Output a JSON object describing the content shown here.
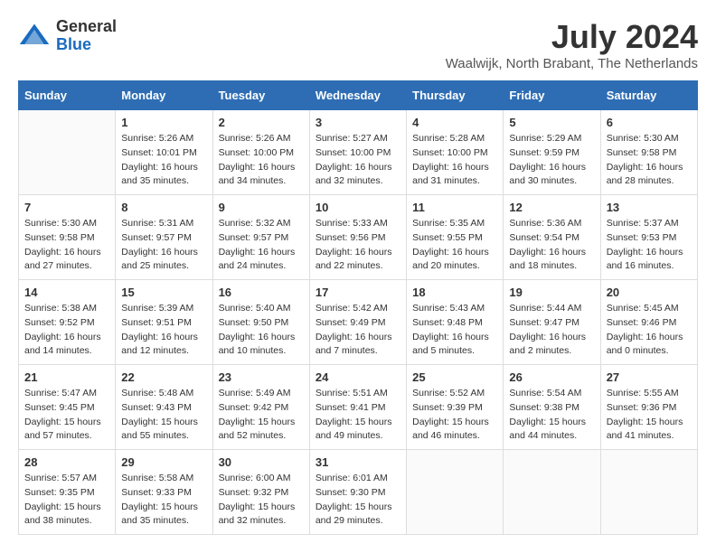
{
  "logo": {
    "general": "General",
    "blue": "Blue"
  },
  "title": "July 2024",
  "location": "Waalwijk, North Brabant, The Netherlands",
  "days_of_week": [
    "Sunday",
    "Monday",
    "Tuesday",
    "Wednesday",
    "Thursday",
    "Friday",
    "Saturday"
  ],
  "weeks": [
    [
      {
        "day": "",
        "info": ""
      },
      {
        "day": "1",
        "info": "Sunrise: 5:26 AM\nSunset: 10:01 PM\nDaylight: 16 hours and 35 minutes."
      },
      {
        "day": "2",
        "info": "Sunrise: 5:26 AM\nSunset: 10:00 PM\nDaylight: 16 hours and 34 minutes."
      },
      {
        "day": "3",
        "info": "Sunrise: 5:27 AM\nSunset: 10:00 PM\nDaylight: 16 hours and 32 minutes."
      },
      {
        "day": "4",
        "info": "Sunrise: 5:28 AM\nSunset: 10:00 PM\nDaylight: 16 hours and 31 minutes."
      },
      {
        "day": "5",
        "info": "Sunrise: 5:29 AM\nSunset: 9:59 PM\nDaylight: 16 hours and 30 minutes."
      },
      {
        "day": "6",
        "info": "Sunrise: 5:30 AM\nSunset: 9:58 PM\nDaylight: 16 hours and 28 minutes."
      }
    ],
    [
      {
        "day": "7",
        "info": "Sunrise: 5:30 AM\nSunset: 9:58 PM\nDaylight: 16 hours and 27 minutes."
      },
      {
        "day": "8",
        "info": "Sunrise: 5:31 AM\nSunset: 9:57 PM\nDaylight: 16 hours and 25 minutes."
      },
      {
        "day": "9",
        "info": "Sunrise: 5:32 AM\nSunset: 9:57 PM\nDaylight: 16 hours and 24 minutes."
      },
      {
        "day": "10",
        "info": "Sunrise: 5:33 AM\nSunset: 9:56 PM\nDaylight: 16 hours and 22 minutes."
      },
      {
        "day": "11",
        "info": "Sunrise: 5:35 AM\nSunset: 9:55 PM\nDaylight: 16 hours and 20 minutes."
      },
      {
        "day": "12",
        "info": "Sunrise: 5:36 AM\nSunset: 9:54 PM\nDaylight: 16 hours and 18 minutes."
      },
      {
        "day": "13",
        "info": "Sunrise: 5:37 AM\nSunset: 9:53 PM\nDaylight: 16 hours and 16 minutes."
      }
    ],
    [
      {
        "day": "14",
        "info": "Sunrise: 5:38 AM\nSunset: 9:52 PM\nDaylight: 16 hours and 14 minutes."
      },
      {
        "day": "15",
        "info": "Sunrise: 5:39 AM\nSunset: 9:51 PM\nDaylight: 16 hours and 12 minutes."
      },
      {
        "day": "16",
        "info": "Sunrise: 5:40 AM\nSunset: 9:50 PM\nDaylight: 16 hours and 10 minutes."
      },
      {
        "day": "17",
        "info": "Sunrise: 5:42 AM\nSunset: 9:49 PM\nDaylight: 16 hours and 7 minutes."
      },
      {
        "day": "18",
        "info": "Sunrise: 5:43 AM\nSunset: 9:48 PM\nDaylight: 16 hours and 5 minutes."
      },
      {
        "day": "19",
        "info": "Sunrise: 5:44 AM\nSunset: 9:47 PM\nDaylight: 16 hours and 2 minutes."
      },
      {
        "day": "20",
        "info": "Sunrise: 5:45 AM\nSunset: 9:46 PM\nDaylight: 16 hours and 0 minutes."
      }
    ],
    [
      {
        "day": "21",
        "info": "Sunrise: 5:47 AM\nSunset: 9:45 PM\nDaylight: 15 hours and 57 minutes."
      },
      {
        "day": "22",
        "info": "Sunrise: 5:48 AM\nSunset: 9:43 PM\nDaylight: 15 hours and 55 minutes."
      },
      {
        "day": "23",
        "info": "Sunrise: 5:49 AM\nSunset: 9:42 PM\nDaylight: 15 hours and 52 minutes."
      },
      {
        "day": "24",
        "info": "Sunrise: 5:51 AM\nSunset: 9:41 PM\nDaylight: 15 hours and 49 minutes."
      },
      {
        "day": "25",
        "info": "Sunrise: 5:52 AM\nSunset: 9:39 PM\nDaylight: 15 hours and 46 minutes."
      },
      {
        "day": "26",
        "info": "Sunrise: 5:54 AM\nSunset: 9:38 PM\nDaylight: 15 hours and 44 minutes."
      },
      {
        "day": "27",
        "info": "Sunrise: 5:55 AM\nSunset: 9:36 PM\nDaylight: 15 hours and 41 minutes."
      }
    ],
    [
      {
        "day": "28",
        "info": "Sunrise: 5:57 AM\nSunset: 9:35 PM\nDaylight: 15 hours and 38 minutes."
      },
      {
        "day": "29",
        "info": "Sunrise: 5:58 AM\nSunset: 9:33 PM\nDaylight: 15 hours and 35 minutes."
      },
      {
        "day": "30",
        "info": "Sunrise: 6:00 AM\nSunset: 9:32 PM\nDaylight: 15 hours and 32 minutes."
      },
      {
        "day": "31",
        "info": "Sunrise: 6:01 AM\nSunset: 9:30 PM\nDaylight: 15 hours and 29 minutes."
      },
      {
        "day": "",
        "info": ""
      },
      {
        "day": "",
        "info": ""
      },
      {
        "day": "",
        "info": ""
      }
    ]
  ]
}
